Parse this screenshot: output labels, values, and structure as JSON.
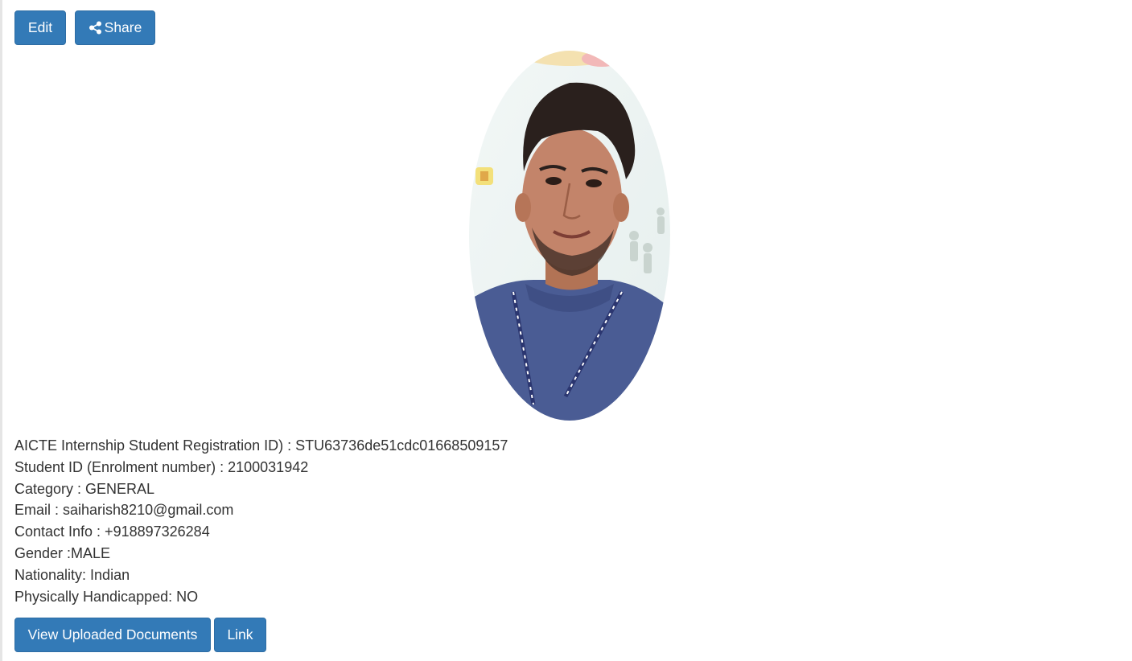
{
  "toolbar": {
    "edit_label": "Edit",
    "share_label": "Share",
    "share_icon": "share-icon"
  },
  "profile": {
    "photo_icon": "profile-photo",
    "registration": "AICTE Internship Student Registration ID) : STU63736de51cdc01668509157",
    "student_id": "Student ID (Enrolment number) : 2100031942",
    "category": "Category : GENERAL",
    "email": "Email : saiharish8210@gmail.com",
    "contact": "Contact Info : +918897326284",
    "gender": "Gender :MALE",
    "nationality": "Nationality: Indian",
    "handicapped": "Physically Handicapped: NO"
  },
  "actions": {
    "view_documents_label": "View Uploaded Documents",
    "link_label": "Link"
  },
  "colors": {
    "button_bg": "#337ab7",
    "button_border": "#2e6da4",
    "text": "#333333"
  }
}
